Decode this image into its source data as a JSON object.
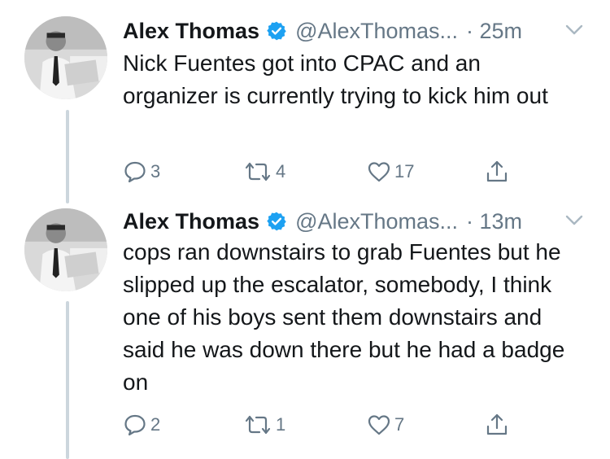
{
  "tweets": [
    {
      "name": "Alex Thomas",
      "handle": "@AlexThomas...",
      "time": "· 25m",
      "text": "Nick Fuentes got into CPAC and an organizer is currently trying to kick him out",
      "replies": "3",
      "retweets": "4",
      "likes": "17"
    },
    {
      "name": "Alex Thomas",
      "handle": "@AlexThomas...",
      "time": "· 13m",
      "text": "cops ran downstairs to grab Fuentes but he slipped up the escalator, somebody, I think one of his boys sent them downstairs and said he was down there but he had a badge on",
      "replies": "2",
      "retweets": "1",
      "likes": "7"
    }
  ],
  "icons": {
    "verified": "verified-badge-icon",
    "caret": "chevron-down-icon",
    "reply": "reply-icon",
    "retweet": "retweet-icon",
    "like": "heart-icon",
    "share": "share-icon"
  },
  "colors": {
    "verified": "#1da1f2",
    "muted": "#657786",
    "thread_line": "#ccd6dd"
  }
}
